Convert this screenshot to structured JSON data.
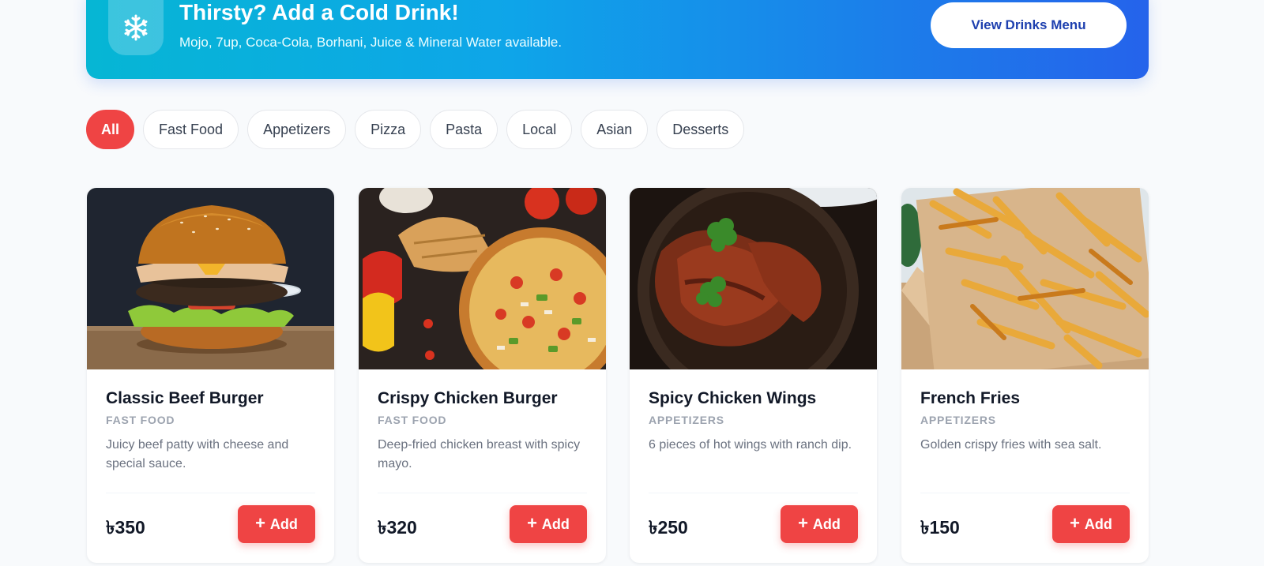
{
  "banner": {
    "icon": "snowflake-icon",
    "title": "Thirsty? Add a Cold Drink!",
    "subtitle": "Mojo, 7up, Coca-Cola, Borhani, Juice & Mineral Water available.",
    "button_label": "View Drinks Menu",
    "gradient_start": "#06b6d4",
    "gradient_end": "#2563eb"
  },
  "filters": {
    "active": "All",
    "items": [
      "All",
      "Fast Food",
      "Appetizers",
      "Pizza",
      "Pasta",
      "Local",
      "Asian",
      "Desserts"
    ]
  },
  "accent_color": "#ef4444",
  "add_label": "Add",
  "add_icon": "plus-icon",
  "products": [
    {
      "image": "burger-photo",
      "name": "Classic Beef Burger",
      "category": "Fast Food",
      "description": "Juicy beef patty with cheese and special sauce.",
      "price": "৳350"
    },
    {
      "image": "pizza-photo",
      "name": "Crispy Chicken Burger",
      "category": "Fast Food",
      "description": "Deep-fried chicken breast with spicy mayo.",
      "price": "৳320"
    },
    {
      "image": "chicken-wings-photo",
      "name": "Spicy Chicken Wings",
      "category": "Appetizers",
      "description": "6 pieces of hot wings with ranch dip.",
      "price": "৳250"
    },
    {
      "image": "french-fries-photo",
      "name": "French Fries",
      "category": "Appetizers",
      "description": "Golden crispy fries with sea salt.",
      "price": "৳150"
    }
  ]
}
